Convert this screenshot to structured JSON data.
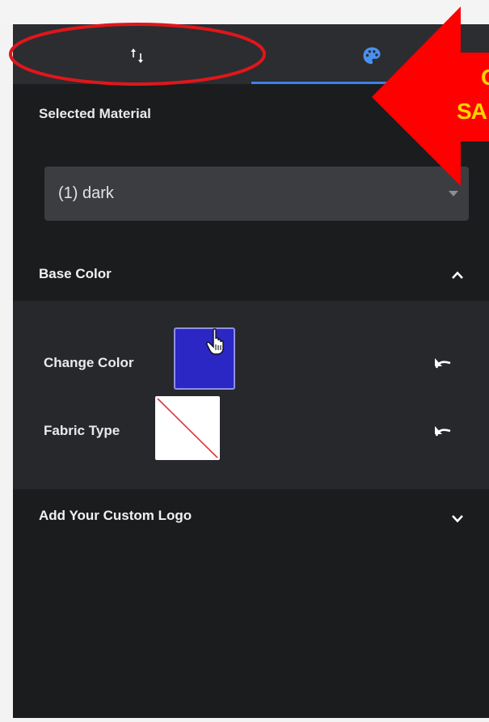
{
  "tabs": [
    {
      "name": "transform",
      "icon": "sort-arrows-icon",
      "active": false
    },
    {
      "name": "material",
      "icon": "palette-icon",
      "active": true
    }
  ],
  "selected_material": {
    "label": "Selected Material",
    "value": "(1) dark"
  },
  "sections": {
    "base_color": {
      "title": "Base Color",
      "expanded": true,
      "change_color": {
        "label": "Change Color",
        "color": "#2a27c4"
      },
      "fabric_type": {
        "label": "Fabric Type",
        "swatch": "none"
      }
    },
    "custom_logo": {
      "title": "Add Your Custom Logo",
      "expanded": false
    }
  },
  "annotation": {
    "line1": "C",
    "line2": "SA",
    "arrow_color": "#ff0000",
    "text_color": "#ffd400",
    "circle_color": "#e0161b"
  },
  "colors": {
    "accent": "#3f80ea",
    "panel_bg": "#1b1c1e",
    "tabbar_bg": "#2b2d31"
  }
}
